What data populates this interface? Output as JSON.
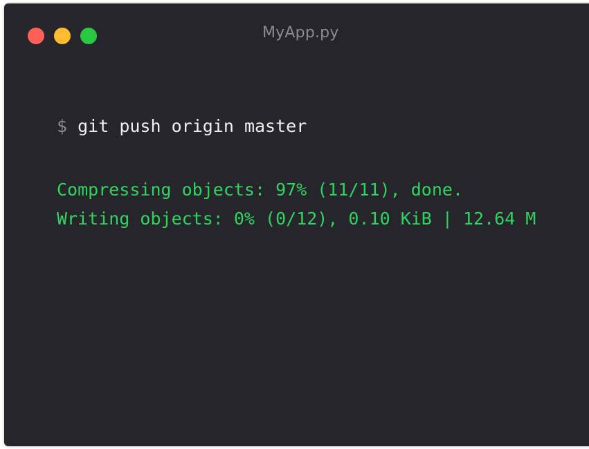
{
  "window": {
    "title": "MyApp.py",
    "buttons": [
      {
        "name": "close",
        "color": "#ff5f57"
      },
      {
        "name": "minimize",
        "color": "#febc2e"
      },
      {
        "name": "maximize",
        "color": "#28c840"
      }
    ]
  },
  "terminal": {
    "prompt": "$",
    "command": "git push origin master",
    "output": [
      "Compressing objects: 97% (11/11), done.",
      "Writing objects: 0% (0/12), 0.10 KiB | 12.64 M"
    ],
    "colors": {
      "background": "#25252b",
      "command_text": "#f0f0f0",
      "prompt": "#8c8c94",
      "output_text": "#2fd45f"
    }
  }
}
